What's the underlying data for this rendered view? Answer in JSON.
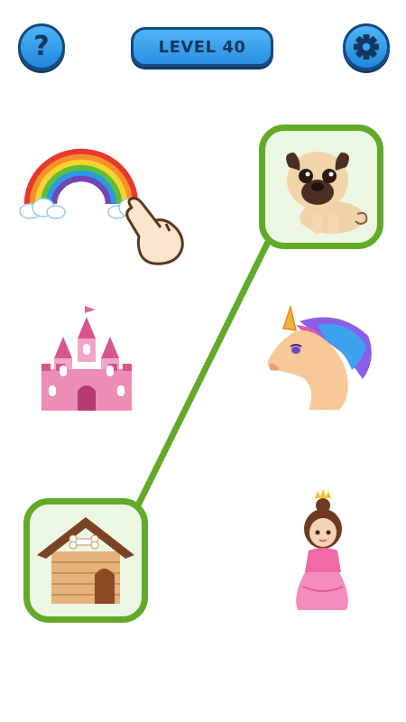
{
  "header": {
    "level_label": "LEVEL 40",
    "help_icon": "question-mark-icon",
    "settings_icon": "gear-icon"
  },
  "left_items": [
    "rainbow",
    "castle",
    "doghouse"
  ],
  "right_items": [
    "pug",
    "unicorn",
    "princess"
  ],
  "connections": [
    {
      "from": "doghouse",
      "to": "pug",
      "state": "matched"
    }
  ],
  "hint": {
    "icon": "pointing-hand-icon",
    "target": "rainbow"
  },
  "colors": {
    "button_blue": "#2a8fe2",
    "outline_navy": "#13497f",
    "match_green": "#62aa2a"
  }
}
